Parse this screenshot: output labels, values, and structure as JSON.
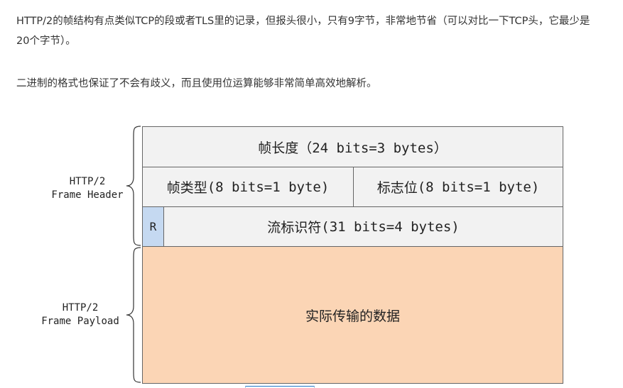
{
  "article": {
    "paragraph1": "HTTP/2的帧结构有点类似TCP的段或者TLS里的记录，但报头很小，只有9字节，非常地节省（可以对比一下TCP头，它最少是20个字节）。",
    "paragraph2": "二进制的格式也保证了不会有歧义，而且使用位运算能够非常简单高效地解析。"
  },
  "diagram": {
    "header_label": [
      "HTTP/2",
      "Frame Header"
    ],
    "payload_label": [
      "HTTP/2",
      "Frame Payload"
    ],
    "fields": {
      "length": {
        "name": "帧长度",
        "size": "（24 bits=3 bytes）"
      },
      "type": {
        "name": "帧类型",
        "size": "(8 bits=1 byte)"
      },
      "flags": {
        "name": "标志位",
        "size": "(8 bits=1 byte)"
      },
      "reserved": {
        "name": "R"
      },
      "stream_id": {
        "name": "流标识符",
        "size": "(31 bits=4 bytes)"
      },
      "payload": {
        "name": "实际传输的数据"
      }
    },
    "colors": {
      "header_fill": "#f2f2f2",
      "reserved_fill": "#c5d9f1",
      "payload_fill": "#fbd5b5",
      "border": "#666666"
    }
  }
}
